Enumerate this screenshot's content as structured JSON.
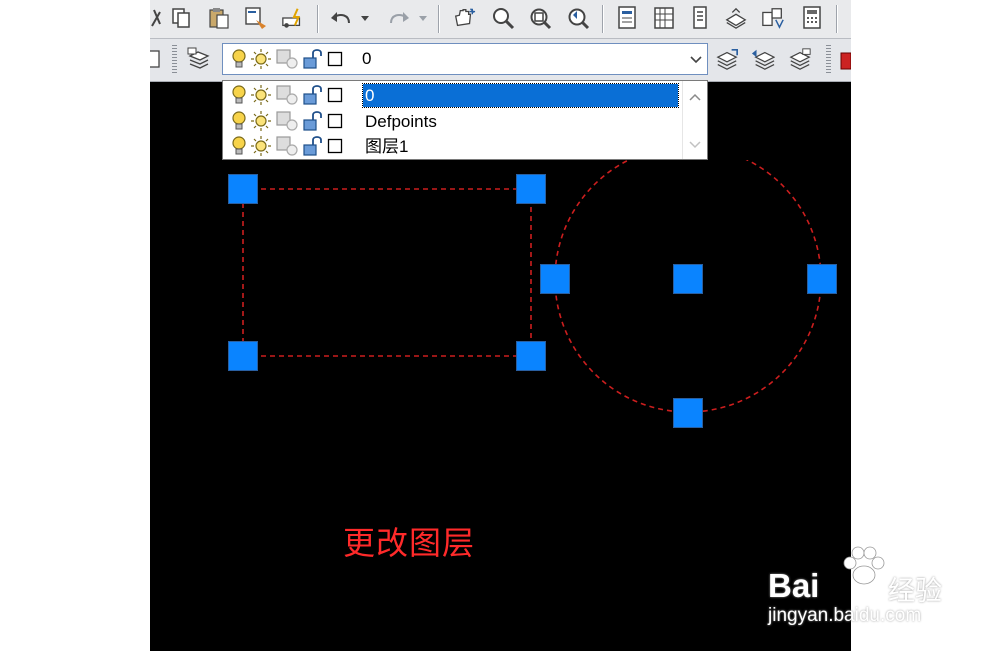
{
  "colors": {
    "canvas": "#000000",
    "grip": "#0a84ff",
    "dashed_geometry": "#cc1e1e",
    "selection": "#0a6fd6",
    "caption": "#ff2a2a"
  },
  "toolbar_standard": {
    "icons": [
      "cut-icon",
      "copy-icon",
      "paste-icon",
      "match-properties-icon",
      "block-editor-icon",
      "undo-icon",
      "undo-dropdown-icon",
      "redo-icon",
      "redo-dropdown-icon",
      "pan-icon",
      "zoom-realtime-icon",
      "zoom-window-icon",
      "zoom-previous-icon",
      "properties-icon",
      "design-center-icon",
      "tool-palettes-icon",
      "sheet-set-icon",
      "markup-icon",
      "quickcalc-icon"
    ]
  },
  "layers_toolbar": {
    "icons": [
      "layer-properties-icon",
      "make-current-icon",
      "layer-previous-icon",
      "layer-states-icon"
    ],
    "current_layer": "0"
  },
  "layer_dropdown": {
    "items": [
      {
        "name": "0",
        "selected": true
      },
      {
        "name": "Defpoints",
        "selected": false
      },
      {
        "name": "图层1",
        "selected": false
      }
    ],
    "row_icons": [
      "on-bulb-icon",
      "thaw-sun-icon",
      "viewport-freeze-icon",
      "unlock-icon",
      "color-swatch-icon"
    ]
  },
  "drawing": {
    "objects": [
      "rectangle",
      "circle"
    ],
    "caption": "更改图层"
  },
  "watermark": {
    "brand": "Bai",
    "brand2": "经验",
    "url": "jingyan.baidu.com"
  }
}
